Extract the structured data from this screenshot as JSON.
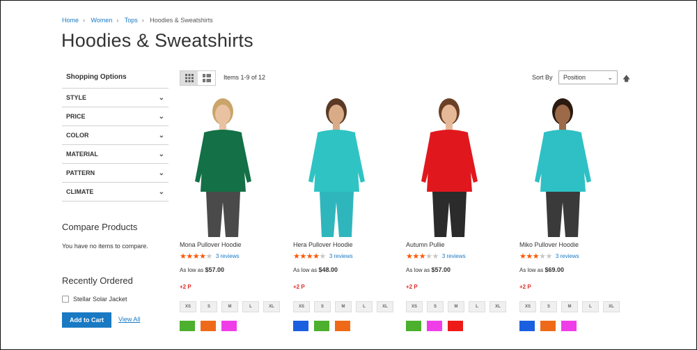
{
  "breadcrumb": [
    "Home",
    "Women",
    "Tops",
    "Hoodies & Sweatshirts"
  ],
  "page_title": "Hoodies & Sweatshirts",
  "sidebar": {
    "title": "Shopping Options",
    "filters": [
      "STYLE",
      "PRICE",
      "COLOR",
      "MATERIAL",
      "PATTERN",
      "CLIMATE"
    ],
    "compare_title": "Compare Products",
    "compare_empty": "You have no items to compare.",
    "recent_title": "Recently Ordered",
    "recent_item": "Stellar Solar Jacket",
    "add_to_cart": "Add to Cart",
    "view_all": "View All"
  },
  "toolbar": {
    "items_count": "Items 1-9 of 12",
    "sort_label": "Sort By",
    "sort_value": "Position",
    "grid_icon": "grid-view-icon",
    "list_icon": "list-view-icon"
  },
  "sizes": [
    "XS",
    "S",
    "M",
    "L",
    "XL"
  ],
  "products": [
    {
      "name": "Mona Pullover Hoodie",
      "rating": 4,
      "reviews": "3 reviews",
      "price_prefix": "As low as",
      "price": "$57.00",
      "points": "+2 P",
      "colors": [
        "#4caf2e",
        "#ef6a18",
        "#ef3ee8"
      ],
      "top": "#137047",
      "bottom": "#4a4a4a",
      "skin": "#e9c2a2",
      "hair": "#c9a56b"
    },
    {
      "name": "Hera Pullover Hoodie",
      "rating": 3.5,
      "reviews": "3 reviews",
      "price_prefix": "As low as",
      "price": "$48.00",
      "points": "+2 P",
      "colors": [
        "#1a5fe0",
        "#4caf2e",
        "#ef6a18"
      ],
      "top": "#2fc3c3",
      "bottom": "#2fb6bd",
      "skin": "#d9ab87",
      "hair": "#5a3a24"
    },
    {
      "name": "Autumn Pullie",
      "rating": 3,
      "reviews": "3 reviews",
      "price_prefix": "As low as",
      "price": "$57.00",
      "points": "+2 P",
      "colors": [
        "#4caf2e",
        "#ef3ee8",
        "#ee1a1a"
      ],
      "top": "#e0181e",
      "bottom": "#2b2b2b",
      "skin": "#e5b898",
      "hair": "#6b4126"
    },
    {
      "name": "Miko Pullover Hoodie",
      "rating": 3,
      "reviews": "3 reviews",
      "price_prefix": "As low as",
      "price": "$69.00",
      "points": "+2 P",
      "colors": [
        "#1a5fe0",
        "#ef6a18",
        "#ef3ee8"
      ],
      "top": "#2ec0c4",
      "bottom": "#3a3a3a",
      "skin": "#9c6a48",
      "hair": "#2a1a10"
    }
  ]
}
